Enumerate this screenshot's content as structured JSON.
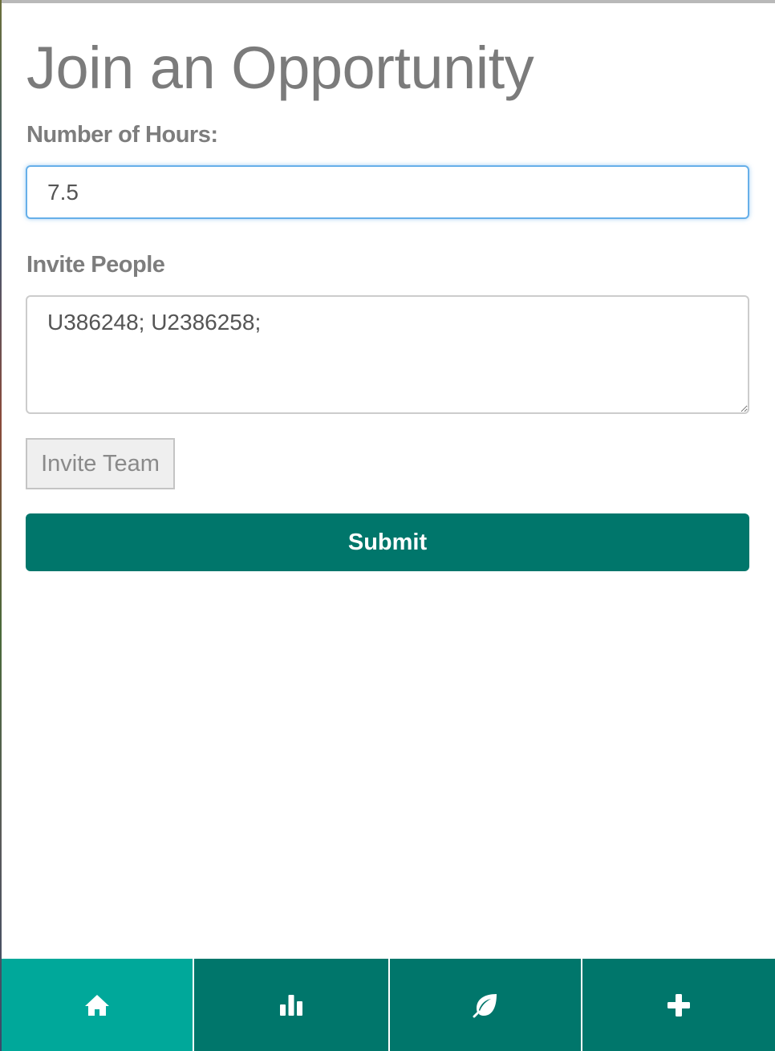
{
  "page": {
    "title": "Join an Opportunity"
  },
  "form": {
    "hours_label": "Number of Hours:",
    "hours_value": "7.5",
    "invite_label": "Invite People",
    "invite_value": "U386248; U2386258;",
    "invite_team_label": "Invite Team",
    "submit_label": "Submit"
  },
  "bottom_nav": {
    "items": [
      {
        "icon": "home-icon",
        "active": true
      },
      {
        "icon": "bar-chart-icon",
        "active": false
      },
      {
        "icon": "leaf-icon",
        "active": false
      },
      {
        "icon": "plus-icon",
        "active": false
      }
    ]
  },
  "colors": {
    "primary": "#00766b",
    "nav_active": "#00a89a",
    "text_muted": "#7b7b7b",
    "focus_border": "#66afe9"
  }
}
